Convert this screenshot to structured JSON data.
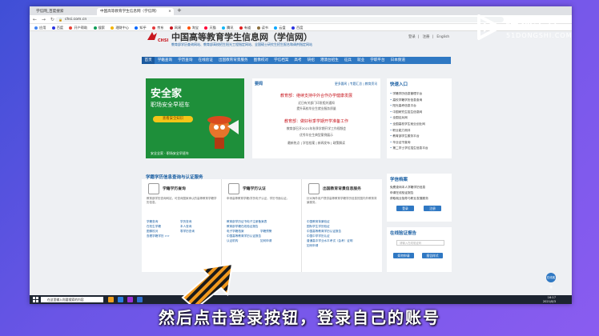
{
  "browser": {
    "tabs": [
      {
        "label": "学信网_百度搜索"
      },
      {
        "label": "中国高等教育学生信息网（学信网）"
      }
    ],
    "new_tab": "+",
    "nav_buttons": "← → ↻",
    "url": "chsi.com.cn",
    "bookmarks": [
      "应用",
      "百度",
      "开户帮助",
      "搜索",
      "理财中心",
      "知乎",
      "京东",
      "网易",
      "淘宝",
      "天猫",
      "腾讯",
      "有道",
      "读书",
      "云盘",
      "百度"
    ]
  },
  "page": {
    "toplinks": [
      "登录",
      "注册",
      "English"
    ],
    "logo_text": "CHSI",
    "site_title": "中国高等教育学生信息网（学信网）",
    "site_subtitle": "教育部学历查询网站、教育部高校招生阳光工程指定网站、全国硕士研究生招生报名和调剂指定网站",
    "nav": [
      "首页",
      "学籍查询",
      "学历查询",
      "在线验证",
      "出国教育背景服务",
      "图像校对",
      "学信档案",
      "高考",
      "研招",
      "港澳台招生",
      "征兵",
      "就业",
      "学职平台",
      "日本频道"
    ],
    "ad": {
      "title": "安全家",
      "subtitle": "职场安全早班车",
      "button": "查看安全知识",
      "footer": "安全全家 · 职场安全早班车"
    },
    "news": {
      "head": "要闻",
      "links": "更多要闻 | 专题汇总 | 教育资讯",
      "items": [
        {
          "text": "教育部：继续支持中外合作办学健康发展",
          "red": true
        },
        {
          "text": "近日有关部门印发相关通知",
          "red": false
        },
        {
          "text": "提升高校毕业生就业服务质量",
          "red": false
        },
        {
          "text": "教育部：做好秋季学期开学准备工作",
          "red": true
        },
        {
          "text": "教育部召开2021年秋季学期开学工作视频会",
          "red": false
        },
        {
          "text": "优秀毕业生典型案例展示",
          "red": false
        },
        {
          "text": "最新热点 | 学信档案 | 新闻发布 | 政策解读",
          "red": false
        }
      ]
    },
    "quick": {
      "head": "快速入口",
      "items": [
        "学籍学历信息管理平台",
        "高校学籍学历信息查询",
        "阳光高考信息平台",
        "中国研究生招生信息网",
        "全国征兵网",
        "全国高校学生就业创业网",
        "职业能力测评",
        "教育部学生服务平台",
        "毕业证书查询",
        "第二学士学位招生信息平台"
      ]
    },
    "services": {
      "head": "学籍学历信息查询与认证服务",
      "cards": [
        {
          "title": "学籍学历查询",
          "desc": "教育部学历查询网站，可查询国家承认的高等教育学籍学历信息。",
          "links": [
            "学籍查询",
            "学历查询",
            "在校生学籍",
            "本人查询",
            "图像校对",
            "零学历查询"
          ],
          "more": "查看学籍学历 >>"
        },
        {
          "title": "学籍学历认证",
          "desc": "申请高等教育学籍/学历电子认证，学历书面认证。",
          "links": [
            "教育部学历证书电子注册备案表",
            "教育部学籍在线验证报告",
            "电子学籍档案",
            "学籍预警",
            "中国高等教育学历认证报告",
            "认证机构"
          ],
          "more": "如何申请"
        },
        {
          "title": "出国教育背景信息服务",
          "desc": "针对海外用户提供高等教育学籍学历信息的国内外教育背景服务。",
          "links": [
            "中国教育背景验证",
            "国际学生学历验证",
            "中国高等教育学历认证报告",
            "中国中学学历认证",
            "普通高中学业水平考试（会考）证明",
            "如何申请"
          ],
          "more": ""
        }
      ]
    },
    "archive": {
      "head": "学信档案",
      "lines": [
        "免费查询本人学籍学历信息",
        "申请在线验证报告",
        "获取就业指导与职业发展服务"
      ],
      "login_button": "登录",
      "register_button": "注册"
    },
    "verify": {
      "head": "在线验证报告",
      "placeholder": "请输入在线验证码",
      "btn1": "如何申请",
      "btn2": "报告样式"
    },
    "help": "在线客服",
    "status_url": "https://my.chsi.com.cn"
  },
  "taskbar": {
    "search_placeholder": "在这里输入你要搜索的内容",
    "time": "16:17",
    "date": "2021/8/3"
  },
  "overlay": {
    "watermark": "懂视生活",
    "watermark_sub": "51DONGSHI.COM",
    "subtitle": "然后点击登录按钮，登录自己的账号"
  }
}
